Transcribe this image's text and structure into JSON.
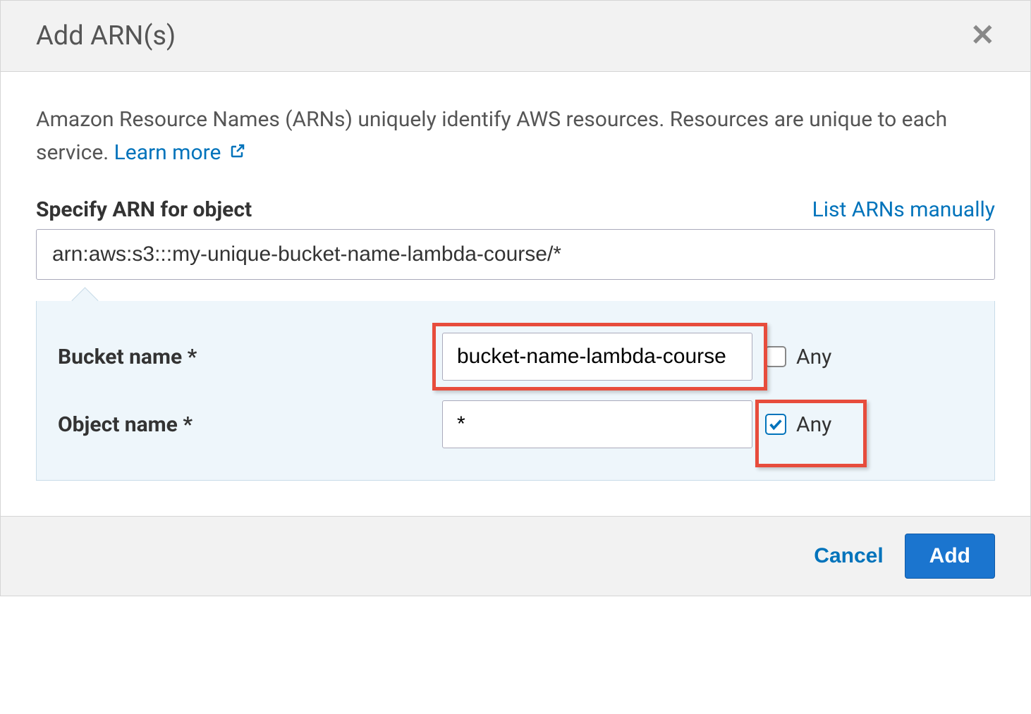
{
  "header": {
    "title": "Add ARN(s)"
  },
  "body": {
    "description_text": "Amazon Resource Names (ARNs) uniquely identify AWS resources. Resources are unique to each service. ",
    "learn_more_label": "Learn more",
    "specify_label": "Specify ARN for object",
    "list_manually_label": "List ARNs manually",
    "arn_value": "arn:aws:s3:::my-unique-bucket-name-lambda-course/*",
    "fields": {
      "bucket": {
        "label": "Bucket name *",
        "value": "bucket-name-lambda-course",
        "any_label": "Any",
        "any_checked": false
      },
      "object": {
        "label": "Object name *",
        "value": "*",
        "any_label": "Any",
        "any_checked": true
      }
    }
  },
  "footer": {
    "cancel_label": "Cancel",
    "add_label": "Add"
  }
}
